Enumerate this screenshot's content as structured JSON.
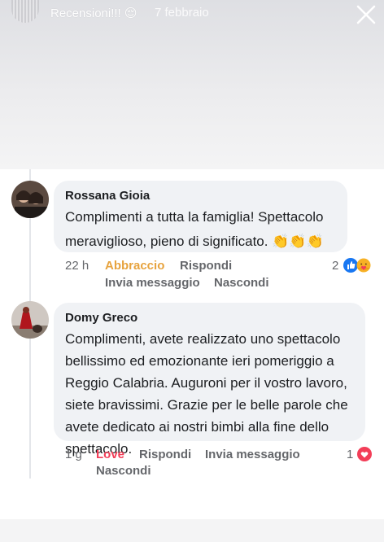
{
  "story": {
    "title": "Recensioni!!! 😌",
    "date": "7 febbraio"
  },
  "comments": [
    {
      "author": "Rossana Gioia",
      "lines": [
        "Complimenti a tutta la famiglia! Spettacolo",
        "meraviglioso, pieno di significato. 👏👏👏"
      ],
      "time": "22 h",
      "reaction_label": "Abbraccio",
      "reply_label": "Rispondi",
      "message_label": "Invia messaggio",
      "hide_label": "Nascondi",
      "reaction_count": "2",
      "reaction_icons": [
        "like-icon",
        "care-icon"
      ]
    },
    {
      "author": "Domy Greco",
      "lines": [
        "Complimenti, avete realizzato uno spettacolo",
        "bellissimo ed emozionante ieri pomeriggio a",
        "Reggio Calabria. Auguroni per il vostro lavoro,",
        "siete bravissimi. Grazie per le belle parole che",
        "avete dedicato ai nostri bimbi alla fine dello",
        "spettacolo."
      ],
      "time": "1 g",
      "reaction_label": "Love",
      "reply_label": "Rispondi",
      "message_label": "Invia messaggio",
      "hide_label": "Nascondi",
      "reaction_count": "1",
      "reaction_icons": [
        "love-icon"
      ]
    }
  ],
  "colors": {
    "abbraccio": "#e7a33e",
    "love": "#f33e58",
    "like": "#1877f2",
    "bubble": "#f0f2f5"
  }
}
